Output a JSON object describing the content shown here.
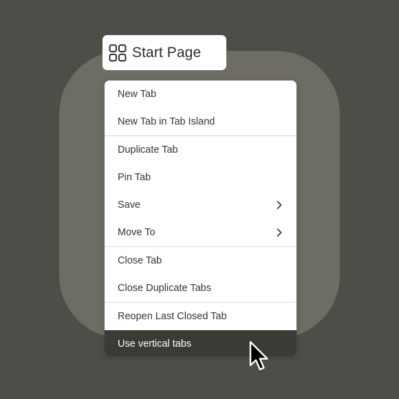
{
  "tab": {
    "title": "Start Page",
    "icon": "grid-icon"
  },
  "menu": {
    "groups": [
      [
        {
          "label": "New Tab",
          "has_submenu": false
        },
        {
          "label": "New Tab in Tab Island",
          "has_submenu": false
        }
      ],
      [
        {
          "label": "Duplicate Tab",
          "has_submenu": false
        },
        {
          "label": "Pin Tab",
          "has_submenu": false
        },
        {
          "label": "Save",
          "has_submenu": true
        },
        {
          "label": "Move To",
          "has_submenu": true
        }
      ],
      [
        {
          "label": "Close Tab",
          "has_submenu": false
        },
        {
          "label": "Close Duplicate Tabs",
          "has_submenu": false
        }
      ],
      [
        {
          "label": "Reopen Last Closed Tab",
          "has_submenu": false
        }
      ],
      [
        {
          "label": "Use vertical tabs",
          "has_submenu": false,
          "highlighted": true
        }
      ]
    ]
  },
  "colors": {
    "background": "#4f4d47",
    "backdrop": "#6e6d64",
    "menu": "#ffffff",
    "highlight": "#3b3a35"
  }
}
